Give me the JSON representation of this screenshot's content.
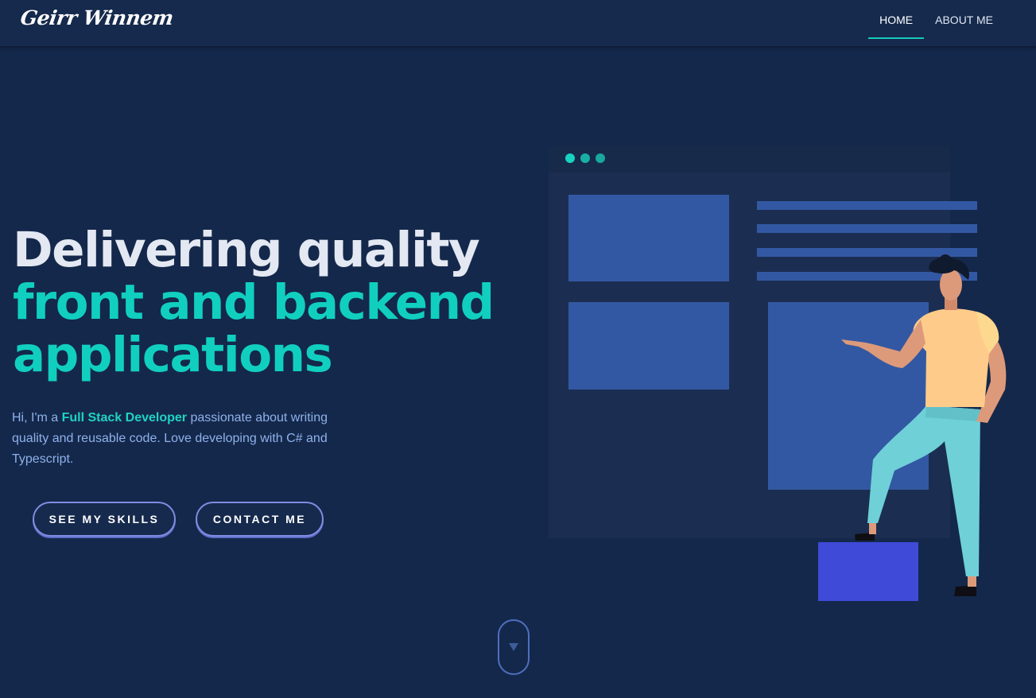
{
  "header": {
    "logo": "Geirr Winnem",
    "nav": [
      {
        "label": "HOME",
        "active": true
      },
      {
        "label": "ABOUT ME",
        "active": false
      }
    ]
  },
  "hero": {
    "headline_line1": "Delivering quality",
    "headline_line2": "front and backend",
    "headline_line3": "applications",
    "intro_prefix": "Hi, I'm a",
    "intro_highlight": "Full Stack Developer",
    "intro_suffix": "passionate about writing quality and reusable code. Love developing with C# and Typescript.",
    "buttons": {
      "skills": "SEE MY SKILLS",
      "contact": "CONTACT ME"
    }
  },
  "scroll_indicator": {
    "icon": "chevron-down-icon"
  },
  "illustration": {
    "subject": "person-pointing-at-website-mockup",
    "colors": {
      "window_bg": "#1b2e52",
      "window_bar": "#172a4a",
      "blocks": "#3358a3",
      "dots": "#18bfb0",
      "box": "#3f4ad9",
      "shirt": "#fecb8a",
      "pants": "#6fd0d8",
      "skin": "#dd9a7a",
      "hair": "#101a2e"
    }
  },
  "colors": {
    "background": "#14284b",
    "accent": "#11cfbf",
    "text_primary": "#e3e8f2",
    "text_secondary": "#8fb1ea",
    "button_border": "#7f8de2"
  }
}
